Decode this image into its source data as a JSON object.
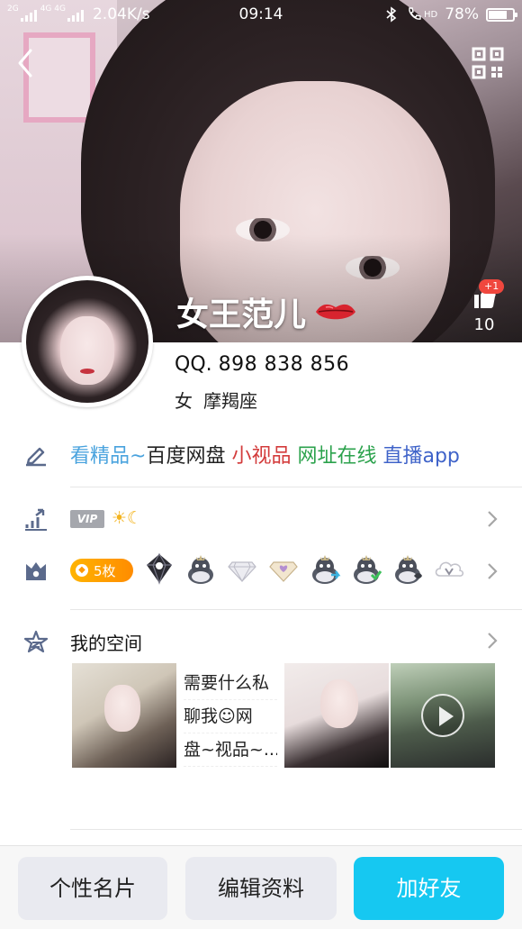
{
  "status_bar": {
    "network_small": "2G",
    "network_large": "4G 4G",
    "speed": "2.04K/s",
    "time": "09:14",
    "hd_label": "HD",
    "battery": "78%",
    "battery_level": 0.78
  },
  "profile": {
    "nickname": "女王范儿",
    "likes": "10",
    "likes_increment": "+1",
    "qq_label": "QQ.",
    "qq_number": "898 838 856",
    "gender": "女",
    "zodiac": "摩羯座"
  },
  "signature": {
    "part1": "看精品~",
    "part2": "百度网盘",
    "part3": "小视品",
    "part4": "网址在线",
    "part5": "直播app"
  },
  "vip": {
    "badge": "VIP",
    "level_icons": "☀☾"
  },
  "badges": {
    "coins": "5枚",
    "items": [
      "diamond-dark",
      "crown-penguin",
      "diamond-white",
      "diamond-gold-heart",
      "penguin-arrow",
      "penguin-check",
      "penguin-fish",
      "v-cloud"
    ]
  },
  "space": {
    "title": "我的空间",
    "text_tile_lines": [
      "需要什么私",
      "聊我☺网",
      "盘~视品~..."
    ]
  },
  "actions": {
    "card": "个性名片",
    "edit": "编辑资料",
    "add_friend": "加好友"
  },
  "colors": {
    "accent": "#16c8f1",
    "sig_blue": "#4aa3de",
    "sig_red": "#d33b3b",
    "sig_green": "#2ba24c",
    "sig_navy": "#3f63c9",
    "coin_orange": "#ff9800"
  }
}
